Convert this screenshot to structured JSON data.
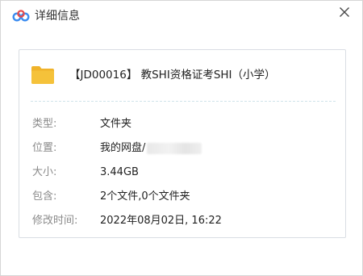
{
  "window": {
    "title": "详细信息"
  },
  "file": {
    "name": "【JD00016】 教SHI资格证考SHI（小学）"
  },
  "details": {
    "type_label": "类型:",
    "type_value": "文件夹",
    "location_label": "位置:",
    "location_value": "我的网盘/",
    "size_label": "大小:",
    "size_value": "3.44GB",
    "contains_label": "包含:",
    "contains_value": "2个文件,0个文件夹",
    "modified_label": "修改时间:",
    "modified_value": "2022年08月02日, 16:22"
  },
  "colors": {
    "logo_blue": "#3b8cf0",
    "logo_red": "#e84a4a",
    "folder_yellow": "#f5c23a",
    "folder_tab": "#f0b32a"
  },
  "icons": {
    "logo": "baidu-netdisk-logo",
    "close": "close-icon",
    "folder": "folder-icon"
  }
}
